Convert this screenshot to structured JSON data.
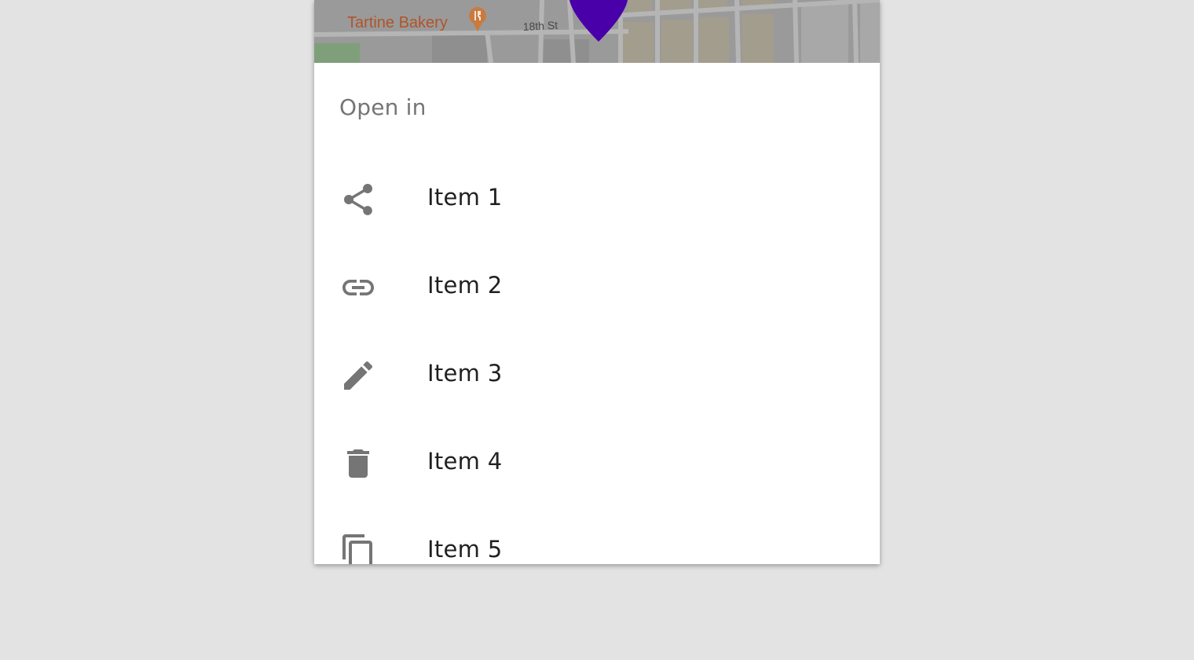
{
  "map": {
    "place_name": "Tartine Bakery",
    "street_label": "18th St",
    "pin_color": "#4a00a8"
  },
  "sheet": {
    "title": "Open in",
    "items": [
      {
        "label": "Item 1",
        "icon": "share-icon"
      },
      {
        "label": "Item 2",
        "icon": "link-icon"
      },
      {
        "label": "Item 3",
        "icon": "edit-icon"
      },
      {
        "label": "Item 4",
        "icon": "delete-icon"
      },
      {
        "label": "Item 5",
        "icon": "copy-icon"
      }
    ]
  },
  "colors": {
    "background": "#e3e3e3",
    "icon": "#757575",
    "text": "#212121",
    "title": "#757575"
  }
}
